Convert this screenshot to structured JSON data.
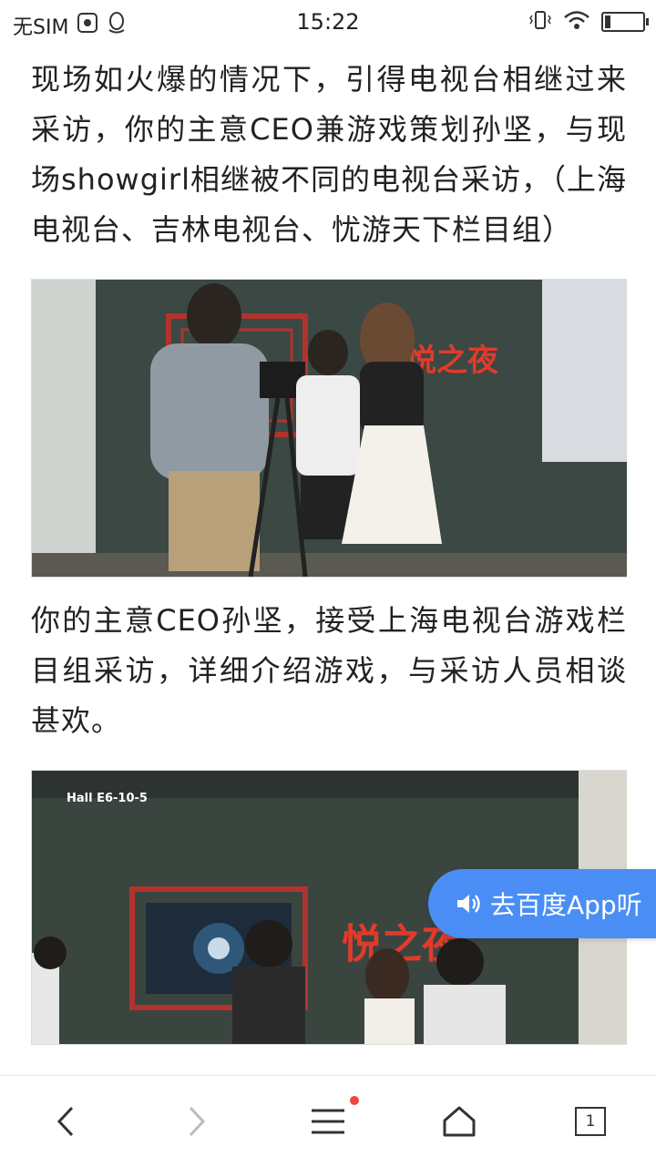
{
  "status_bar": {
    "carrier": "无SIM",
    "time": "15:22"
  },
  "article": {
    "paragraph1": "现场如火爆的情况下，引得电视台相继过来采访，你的主意CEO兼游戏策划孙坚，与现场showgirl相继被不同的电视台采访，（上海电视台、吉林电视台、忧游天下栏目组）",
    "image1_sign": "悦之夜",
    "paragraph2": "你的主意CEO孙坚，接受上海电视台游戏栏目组采访，详细介绍游戏，与采访人员相谈甚欢。",
    "image2_hall": "Hall E6-10-5",
    "image2_sign": "悦之夜"
  },
  "float_button": {
    "label": "去百度App听"
  },
  "bottom_nav": {
    "tab_count": "1"
  },
  "colors": {
    "accent": "#4a8ef5",
    "badge": "#f0483e"
  }
}
